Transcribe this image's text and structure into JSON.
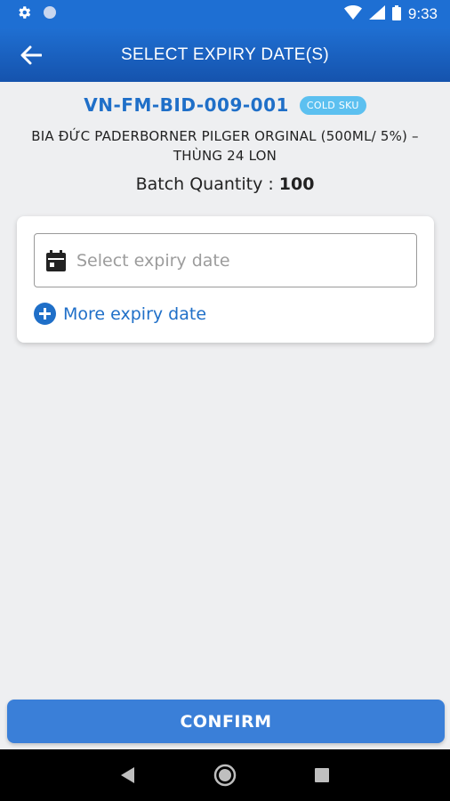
{
  "status_bar": {
    "time": "9:33",
    "icons": [
      "gear-icon",
      "circle-icon",
      "wifi-icon",
      "signal-icon",
      "battery-icon"
    ]
  },
  "app_bar": {
    "title": "SELECT EXPIRY DATE(S)",
    "back_icon": "arrow-left-icon"
  },
  "product": {
    "sku_code": "VN-FM-BID-009-001",
    "badge": "COLD SKU",
    "name": "BIA ĐỨC PADERBORNER PILGER ORGINAL (500ML/ 5%) – THÙNG 24 LON",
    "batch_label": "Batch Quantity :",
    "batch_value": "100"
  },
  "expiry": {
    "placeholder": "Select expiry date",
    "value": "",
    "more_label": "More expiry date"
  },
  "actions": {
    "confirm_label": "CONFIRM"
  },
  "colors": {
    "primary": "#1f6fd2",
    "accent_text": "#1f6fc8",
    "badge": "#5cc0f0",
    "confirm": "#3a7fd8"
  }
}
